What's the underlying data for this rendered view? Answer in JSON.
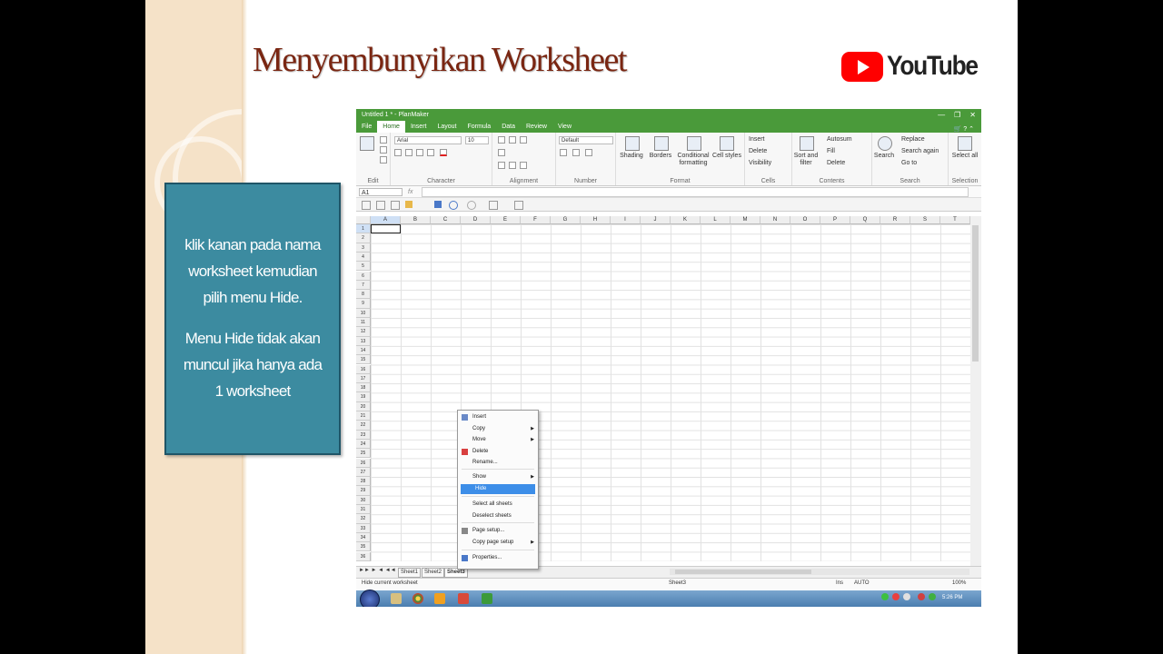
{
  "slide": {
    "title": "Menyembunyikan Worksheet",
    "youtube_text": "YouTube",
    "callout": [
      "klik kanan pada nama\nworksheet kemudian\npilih menu Hide.",
      "Menu Hide tidak akan\nmuncul jika hanya ada\n1  worksheet"
    ]
  },
  "app": {
    "window_title": "Untitled 1 * - PlanMaker",
    "tabs": [
      "File",
      "Home",
      "Insert",
      "Layout",
      "Formula",
      "Data",
      "Review",
      "View"
    ],
    "active_tab": "Home",
    "ribbon": {
      "font_name": "Arial",
      "font_size": "10",
      "number_format": "Default",
      "groups": [
        "Edit",
        "Character",
        "Alignment",
        "Number",
        "Format",
        "Cells",
        "Contents",
        "Search",
        "Selection"
      ],
      "shading": "Shading",
      "borders": "Borders",
      "conditional": "Conditional formatting",
      "cell_styles": "Cell styles",
      "insert": "Insert",
      "delete": "Delete",
      "visibility": "Visibility",
      "sort_filter": "Sort and filter",
      "autosum": "Autosum",
      "fill": "Fill",
      "delete2": "Delete",
      "search": "Search",
      "replace": "Replace",
      "search_again": "Search again",
      "go_to": "Go to",
      "select_all": "Select all"
    },
    "name_box": "A1",
    "fx": "fx",
    "columns": [
      "A",
      "B",
      "C",
      "D",
      "E",
      "F",
      "G",
      "H",
      "I",
      "J",
      "K",
      "L",
      "M",
      "N",
      "O",
      "P",
      "Q",
      "R",
      "S",
      "T"
    ],
    "rows": [
      "1",
      "2",
      "3",
      "4",
      "5",
      "6",
      "7",
      "8",
      "9",
      "10",
      "11",
      "12",
      "13",
      "14",
      "15",
      "16",
      "17",
      "18",
      "19",
      "20",
      "21",
      "22",
      "23",
      "24",
      "25",
      "26",
      "27",
      "28",
      "29",
      "30",
      "31",
      "32",
      "33",
      "34",
      "35",
      "36"
    ],
    "sheet_tabs": [
      "Sheet1",
      "Sheet2",
      "Sheet3"
    ],
    "active_sheet": "Sheet3",
    "context_menu": [
      {
        "label": "Insert",
        "submenu": false
      },
      {
        "label": "Copy",
        "submenu": true
      },
      {
        "label": "Move",
        "submenu": true
      },
      {
        "label": "Delete",
        "submenu": false
      },
      {
        "label": "Rename...",
        "submenu": false
      },
      {
        "label": "Show",
        "submenu": true
      },
      {
        "label": "Hide",
        "submenu": false,
        "highlighted": true
      },
      {
        "label": "Select all sheets",
        "submenu": false
      },
      {
        "label": "Deselect sheets",
        "submenu": false
      },
      {
        "label": "Page setup...",
        "submenu": false
      },
      {
        "label": "Copy page setup",
        "submenu": true
      },
      {
        "label": "Properties...",
        "submenu": false
      }
    ],
    "status": {
      "hint": "Hide current worksheet",
      "sheet": "Sheet3",
      "ins": "Ins",
      "auto": "AUTO",
      "zoom": "100%"
    },
    "clock": "5:26 PM"
  },
  "colors": {
    "title_color": "#7a2612",
    "callout_bg": "#3c8ba0",
    "app_green": "#4a9a3a",
    "highlight": "#3d8ee8"
  }
}
